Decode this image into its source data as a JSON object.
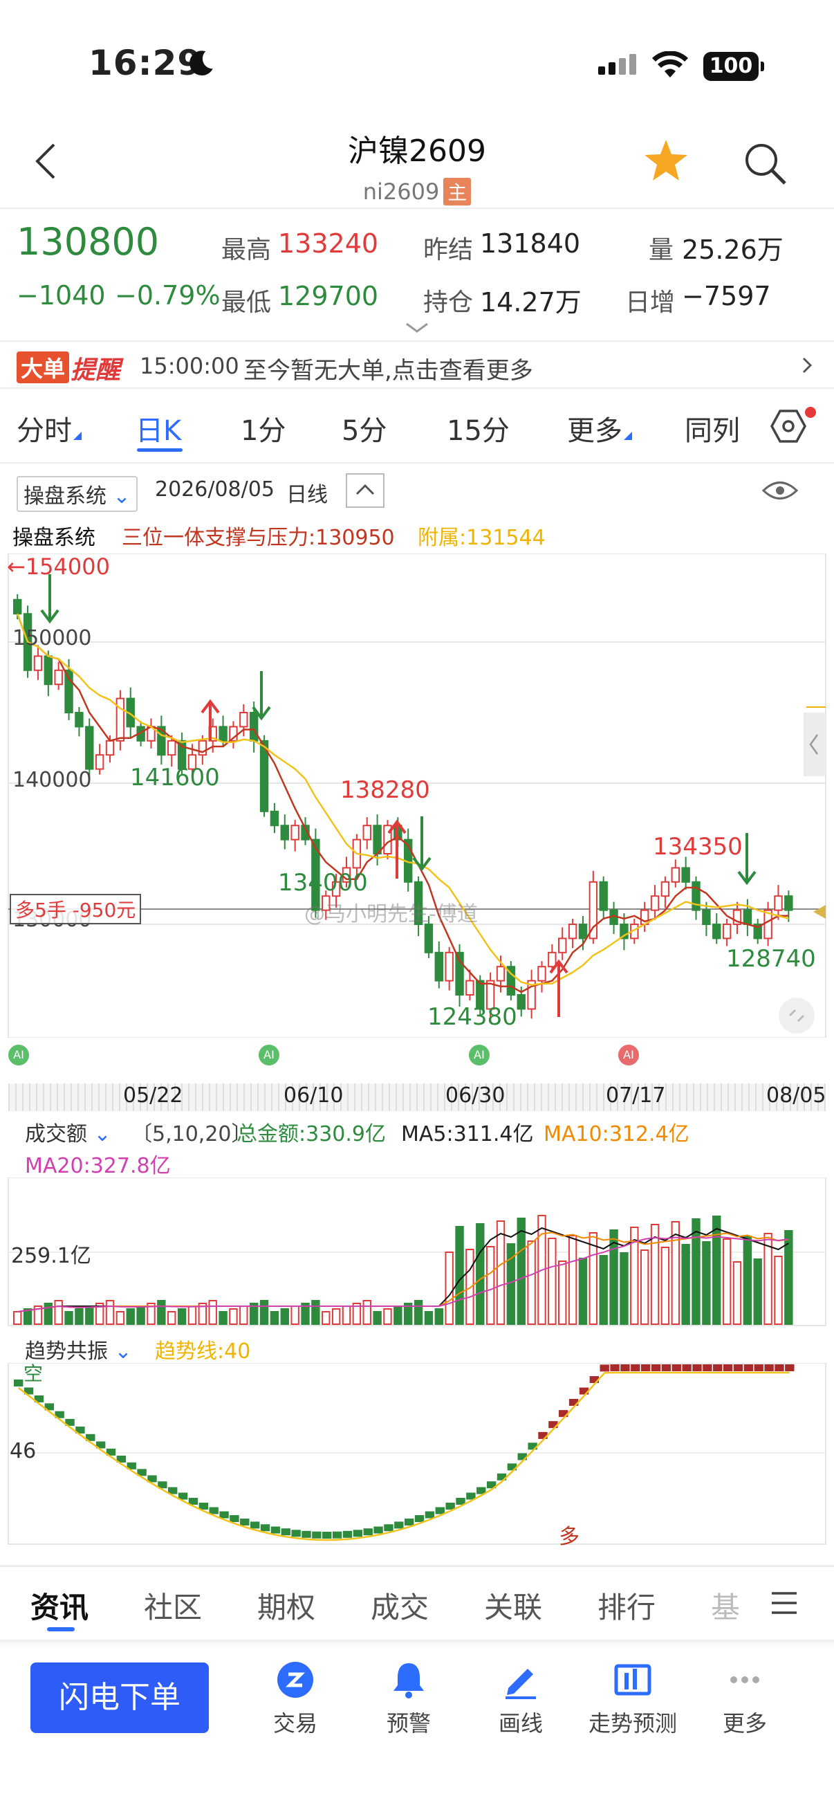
{
  "status_bar": {
    "time": "16:29",
    "battery": "100"
  },
  "header": {
    "title": "沪镍2609",
    "subtitle": "ni2609",
    "main_badge": "主"
  },
  "quote": {
    "price": "130800",
    "change": "−1040",
    "change_pct": "−0.79%",
    "high_label": "最高",
    "high": "133240",
    "low_label": "最低",
    "low": "129700",
    "prev_settle_label": "昨结",
    "prev_settle": "131840",
    "open_interest_label": "持仓",
    "open_interest": "14.27万",
    "volume_label": "量",
    "volume": "25.26万",
    "daily_increase_label": "日增",
    "daily_increase": "−7597"
  },
  "alert": {
    "badge": "大单",
    "badge2": "提醒",
    "time": "15:00:00",
    "message": "至今暂无大单,点击查看更多"
  },
  "tabs": [
    {
      "label": "分时"
    },
    {
      "label": "日K"
    },
    {
      "label": "1分"
    },
    {
      "label": "5分"
    },
    {
      "label": "15分"
    },
    {
      "label": "更多"
    },
    {
      "label": "同列"
    }
  ],
  "chart_header": {
    "system_select": "操盘系统",
    "date": "2026/08/05",
    "period": "日线",
    "line2_title": "操盘系统",
    "support_label": "三位一体支撑与压力:130950",
    "attach_label": "附属:131544"
  },
  "kline": {
    "y_labels": [
      "150000",
      "140000",
      "130000"
    ],
    "top_marker": "←154000",
    "annotations": [
      "141600",
      "134000",
      "138280",
      "124380",
      "134350",
      "128740"
    ],
    "position_tag": "多5手 -950元",
    "watermark": "@马小明先生-傅道",
    "x_dates": [
      "05/22",
      "06/10",
      "06/30",
      "07/17",
      "08/05"
    ],
    "ai_badge": "AI"
  },
  "volume": {
    "selector": "成交额",
    "params": "〔5,10,20〕",
    "total": "总金额:330.9亿",
    "ma5": "MA5:311.4亿",
    "ma10": "MA10:312.4亿",
    "ma20": "MA20:327.8亿",
    "y_label": "259.1亿"
  },
  "trend": {
    "selector": "趋势共振",
    "line_label": "趋势线:40",
    "y_label": "46",
    "kong": "空",
    "duo": "多"
  },
  "bottom_tabs": [
    "资讯",
    "社区",
    "期权",
    "成交",
    "关联",
    "排行",
    "基"
  ],
  "dock": {
    "flash_order": "闪电下单",
    "items": [
      "交易",
      "预警",
      "画线",
      "走势预测",
      "更多"
    ]
  },
  "colors": {
    "up": "#e03a3a",
    "down": "#2e8b3e",
    "accent": "#2c6cff",
    "trend_yellow": "#f2c21b"
  }
}
